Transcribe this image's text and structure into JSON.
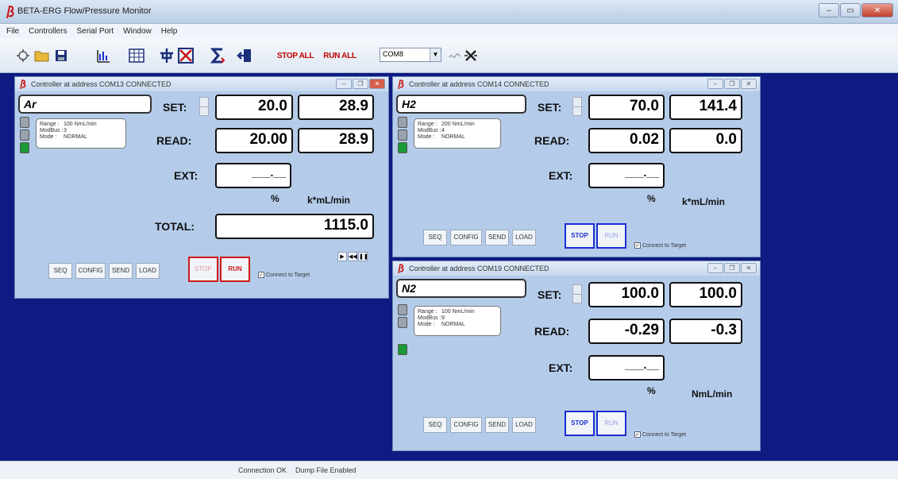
{
  "window": {
    "title": "BETA-ERG Flow/Pressure Monitor"
  },
  "menu": [
    "File",
    "Controllers",
    "Serial Port",
    "Window",
    "Help"
  ],
  "toolbar": {
    "stop_all": "STOP ALL",
    "run_all": "RUN ALL",
    "port": "COM8",
    "icons": [
      "new-icon",
      "open-folder-icon",
      "save-icon",
      "graph-icon",
      "table-icon",
      "plug-icon",
      "disconnect-icon",
      "sigma-icon",
      "exit-icon",
      "signal-icon",
      "cross-arrows-icon"
    ]
  },
  "controllers": [
    {
      "title": "Controller at address COM13 CONNECTED",
      "gas": "Ar",
      "range_key": "Range :",
      "range": "100 NmL/min",
      "modbus_key": "ModBus :",
      "modbus": "3",
      "mode_key": "Mode :",
      "mode": "NORMAL",
      "set_label": "SET:",
      "set_pct": "20.0",
      "set_flow": "28.9",
      "read_label": "READ:",
      "read_pct": "20.00",
      "read_flow": "28.9",
      "ext_label": "EXT:",
      "ext_value": "___.__",
      "unit_pct": "%",
      "unit_flow": "k*mL/min",
      "total_label": "TOTAL:",
      "total_value": "1115.0",
      "buttons": {
        "seq": "SEQ",
        "config": "CONFIG",
        "send": "SEND",
        "load": "LOAD",
        "stop": "STOP",
        "run": "RUN"
      },
      "connect_label": "Connect to Target"
    },
    {
      "title": "Controller at address COM14 CONNECTED",
      "gas": "H2",
      "range_key": "Range :",
      "range": "200 NmL/min",
      "modbus_key": "ModBus :",
      "modbus": "4",
      "mode_key": "Mode :",
      "mode": "NORMAL",
      "set_label": "SET:",
      "set_pct": "70.0",
      "set_flow": "141.4",
      "read_label": "READ:",
      "read_pct": "0.02",
      "read_flow": "0.0",
      "ext_label": "EXT:",
      "ext_value": "___.__",
      "unit_pct": "%",
      "unit_flow": "k*mL/min",
      "buttons": {
        "seq": "SEQ",
        "config": "CONFIG",
        "send": "SEND",
        "load": "LOAD",
        "stop": "STOP",
        "run": "RUN"
      },
      "connect_label": "Connect to Target"
    },
    {
      "title": "Controller at address COM19 CONNECTED",
      "gas": "N2",
      "range_key": "Range :",
      "range": "100 NmL/min",
      "modbus_key": "ModBus :",
      "modbus": "9",
      "mode_key": "Mode :",
      "mode": "NORMAL",
      "set_label": "SET:",
      "set_pct": "100.0",
      "set_flow": "100.0",
      "read_label": "READ:",
      "read_pct": "-0.29",
      "read_flow": "-0.3",
      "ext_label": "EXT:",
      "ext_value": "___.__",
      "unit_pct": "%",
      "unit_flow": "NmL/min",
      "buttons": {
        "seq": "SEQ",
        "config": "CONFIG",
        "send": "SEND",
        "load": "LOAD",
        "stop": "STOP",
        "run": "RUN"
      },
      "connect_label": "Connect to Target"
    }
  ],
  "status": {
    "connection": "Connection OK",
    "dump": "Dump File Enabled"
  },
  "colors": {
    "workspace": "#0f1a82",
    "panel": "#b4ccea",
    "run_red": "#d01818",
    "stop_blue": "#1a2fd1",
    "led_green": "#1b9a35"
  }
}
